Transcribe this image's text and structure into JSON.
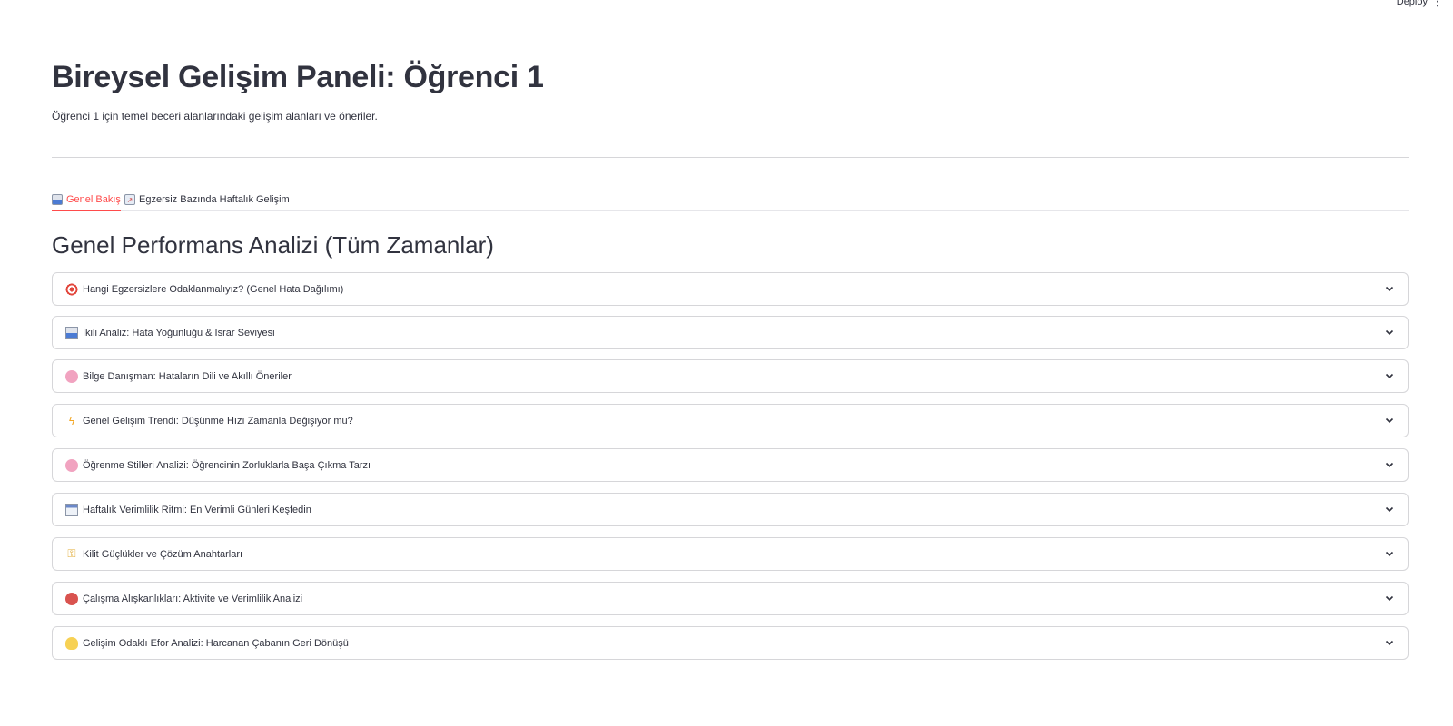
{
  "topbar": {
    "deploy_label": "Deploy",
    "menu_icon": "kebab-menu-icon"
  },
  "header": {
    "title": "Bireysel Gelişim Paneli: Öğrenci 1",
    "subtitle": "Öğrenci 1 için temel beceri alanlarındaki gelişim alanları ve öneriler."
  },
  "tabs": [
    {
      "label": "Genel Bakış",
      "icon": "bar-chart-icon",
      "active": true
    },
    {
      "label": "Egzersiz Bazında Haftalık Gelişim",
      "icon": "trend-chart-icon",
      "active": false
    }
  ],
  "section": {
    "title": "Genel Performans Analizi (Tüm Zamanlar)"
  },
  "expanders": [
    {
      "label": "Hangi Egzersizlere Odaklanmalıyız? (Genel Hata Dağılımı)",
      "icon": "target-icon"
    },
    {
      "label": "İkili Analiz: Hata Yoğunluğu & Israr Seviyesi",
      "icon": "bar-chart-icon"
    },
    {
      "label": "Bilge Danışman: Hataların Dili ve Akıllı Öneriler",
      "icon": "brain-icon"
    },
    {
      "label": "Genel Gelişim Trendi: Düşünme Hızı Zamanla Değişiyor mu?",
      "icon": "lightning-icon"
    },
    {
      "label": "Öğrenme Stilleri Analizi: Öğrencinin Zorluklarla Başa Çıkma Tarzı",
      "icon": "brain-icon"
    },
    {
      "label": "Haftalık Verimlilik Ritmi: En Verimli Günleri Keşfedin",
      "icon": "calendar-icon"
    },
    {
      "label": "Kilit Güçlükler ve Çözüm Anahtarları",
      "icon": "key-icon"
    },
    {
      "label": "Çalışma Alışkanlıkları: Aktivite ve Verimlilik Analizi",
      "icon": "alarm-icon"
    },
    {
      "label": "Gelişim Odaklı Efor Analizi: Harcanan Çabanın Geri Dönüşü",
      "icon": "lightbulb-icon"
    }
  ],
  "colors": {
    "accent": "#ff4b4b",
    "text": "#31333f",
    "border": "#d6d6d9"
  }
}
